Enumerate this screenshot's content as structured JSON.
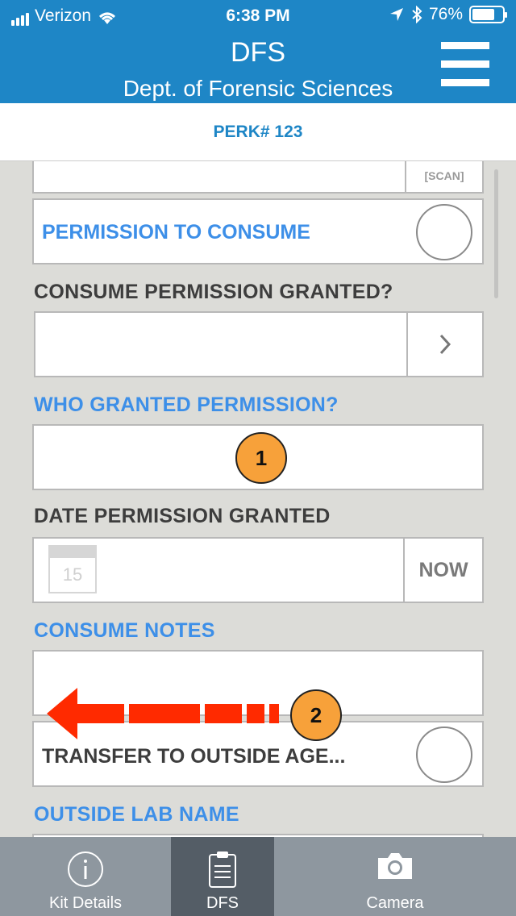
{
  "status": {
    "carrier": "Verizon",
    "time": "6:38 PM",
    "battery": "76%",
    "battery_level": 0.76
  },
  "header": {
    "title": "DFS",
    "subtitle": "Dept. of Forensic Sciences"
  },
  "perk": {
    "label": "PERK# 123"
  },
  "form": {
    "scan_label": "[SCAN]",
    "permission_to_consume": "PERMISSION TO CONSUME",
    "consume_permission_granted": "CONSUME PERMISSION GRANTED?",
    "who_granted": "WHO GRANTED PERMISSION?",
    "date_permission_granted": "DATE PERMISSION GRANTED",
    "calendar_day": "15",
    "now_button": "NOW",
    "consume_notes": "CONSUME NOTES",
    "transfer_outside": "TRANSFER TO OUTSIDE AGE...",
    "outside_lab_name": "OUTSIDE LAB NAME"
  },
  "annotations": {
    "badge1": "1",
    "badge2": "2"
  },
  "tabs": [
    {
      "label": "Kit Details",
      "icon": "info-icon"
    },
    {
      "label": "DFS",
      "icon": "clipboard-icon"
    },
    {
      "label": "Camera",
      "icon": "camera-icon"
    }
  ]
}
